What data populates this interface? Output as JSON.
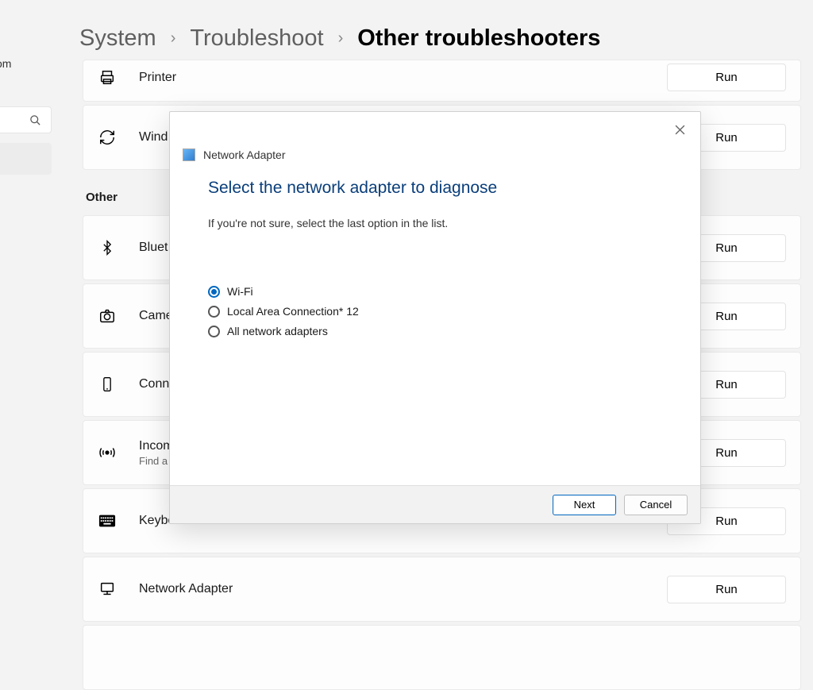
{
  "left": {
    "label": "om"
  },
  "breadcrumbs": {
    "level1": "System",
    "level2": "Troubleshoot",
    "current": "Other troubleshooters"
  },
  "section_other": "Other",
  "run_label": "Run",
  "items": {
    "printer": {
      "label": "Printer"
    },
    "windows_update": {
      "label": "Wind"
    },
    "bluetooth": {
      "label": "Bluet"
    },
    "camera": {
      "label": "Came"
    },
    "connected_devices": {
      "label": "Conn"
    },
    "incoming": {
      "label": "Incom",
      "sub": "Find a"
    },
    "keyboard": {
      "label": "Keyboard"
    },
    "network_adapter": {
      "label": "Network Adapter"
    }
  },
  "modal": {
    "title": "Network Adapter",
    "heading": "Select the network adapter to diagnose",
    "subtext": "If you're not sure, select the last option in the list.",
    "options": {
      "wifi": "Wi-Fi",
      "lac": "Local Area Connection* 12",
      "all": "All network adapters"
    },
    "next": "Next",
    "cancel": "Cancel"
  }
}
